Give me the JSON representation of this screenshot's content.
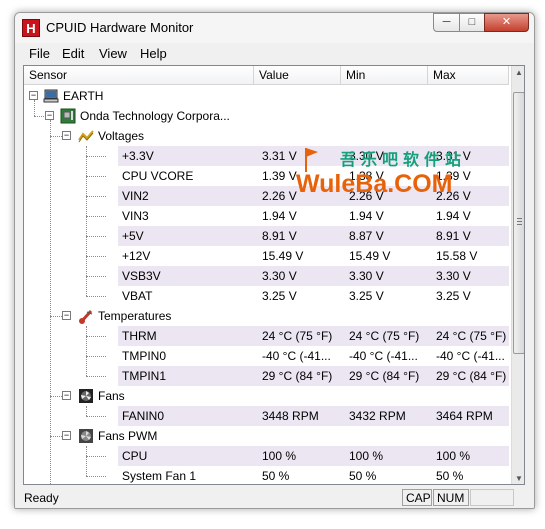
{
  "window": {
    "title": "CPUID Hardware Monitor",
    "app_icon_letter": "H"
  },
  "titlebar_buttons": {
    "minimize": "─",
    "maximize": "□",
    "close": "✕"
  },
  "menu": [
    "File",
    "Edit",
    "View",
    "Help"
  ],
  "columns": [
    "Sensor",
    "Value",
    "Min",
    "Max"
  ],
  "tree": {
    "root": {
      "label": "EARTH",
      "icon": "computer-icon"
    },
    "device": {
      "label": "Onda Technology Corpora...",
      "icon": "motherboard-icon"
    },
    "groups": [
      {
        "label": "Voltages",
        "icon": "voltage-icon",
        "sensors": [
          {
            "name": "+3.3V",
            "value": "3.31 V",
            "min": "3.30 V",
            "max": "3.31 V"
          },
          {
            "name": "CPU VCORE",
            "value": "1.39 V",
            "min": "1.38 V",
            "max": "1.39 V"
          },
          {
            "name": "VIN2",
            "value": "2.26 V",
            "min": "2.26 V",
            "max": "2.26 V"
          },
          {
            "name": "VIN3",
            "value": "1.94 V",
            "min": "1.94 V",
            "max": "1.94 V"
          },
          {
            "name": "+5V",
            "value": "8.91 V",
            "min": "8.87 V",
            "max": "8.91 V"
          },
          {
            "name": "+12V",
            "value": "15.49 V",
            "min": "15.49 V",
            "max": "15.58 V"
          },
          {
            "name": "VSB3V",
            "value": "3.30 V",
            "min": "3.30 V",
            "max": "3.30 V"
          },
          {
            "name": "VBAT",
            "value": "3.25 V",
            "min": "3.25 V",
            "max": "3.25 V"
          }
        ]
      },
      {
        "label": "Temperatures",
        "icon": "thermometer-icon",
        "sensors": [
          {
            "name": "THRM",
            "value": "24 °C  (75 °F)",
            "min": "24 °C  (75 °F)",
            "max": "24 °C  (75 °F)"
          },
          {
            "name": "TMPIN0",
            "value": "-40 °C  (-41...",
            "min": "-40 °C  (-41...",
            "max": "-40 °C  (-41..."
          },
          {
            "name": "TMPIN1",
            "value": "29 °C  (84 °F)",
            "min": "29 °C  (84 °F)",
            "max": "29 °C  (84 °F)"
          }
        ]
      },
      {
        "label": "Fans",
        "icon": "fan-icon",
        "sensors": [
          {
            "name": "FANIN0",
            "value": "3448 RPM",
            "min": "3432 RPM",
            "max": "3464 RPM"
          }
        ]
      },
      {
        "label": "Fans PWM",
        "icon": "fan-pwm-icon",
        "sensors": [
          {
            "name": "CPU",
            "value": "100 %",
            "min": "100 %",
            "max": "100 %"
          },
          {
            "name": "System Fan 1",
            "value": "50 %",
            "min": "50 %",
            "max": "50 %"
          }
        ]
      }
    ]
  },
  "status": {
    "text": "Ready",
    "cap": "CAP",
    "num": "NUM"
  },
  "watermark": {
    "cn": "吾乐吧软件站",
    "en": "WuleBa.COM"
  },
  "colors": {
    "row_shade": "#ebe6f2",
    "close_button": "#c4402e",
    "watermark_green": "#14a07a",
    "watermark_orange": "#e8620a"
  }
}
